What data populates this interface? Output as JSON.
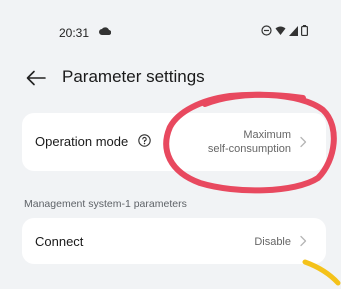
{
  "status_bar": {
    "time": "20:31",
    "icons": [
      "cloud-icon",
      "do-not-disturb-icon",
      "wifi-icon",
      "signal-icon",
      "battery-icon"
    ]
  },
  "header": {
    "title": "Parameter settings",
    "back_icon": "arrow-left-icon"
  },
  "settings": {
    "operation_mode": {
      "label": "Operation mode",
      "value_line1": "Maximum",
      "value_line2": "self-consumption",
      "help_icon": "question-circle-icon"
    },
    "section_header": "Management system-1 parameters",
    "connect": {
      "label": "Connect",
      "value": "Disable"
    }
  },
  "colors": {
    "background": "#f1f3f5",
    "card": "#ffffff",
    "annotation_red": "#e8495f",
    "annotation_yellow": "#f4c21a"
  }
}
